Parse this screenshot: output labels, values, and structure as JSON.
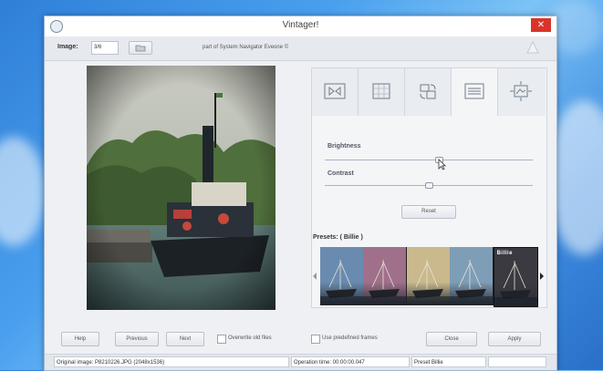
{
  "window": {
    "title": "Vintager!",
    "close_label": "✕"
  },
  "toolbar": {
    "image_label": "Image:",
    "image_value": "3/6",
    "browse_label": "...",
    "credit": "part of System Navigator Eveone ©"
  },
  "panel": {
    "tools": [
      {
        "icon": "frame-icon"
      },
      {
        "icon": "crop-icon"
      },
      {
        "icon": "rotate-icon"
      },
      {
        "icon": "adjust-icon"
      },
      {
        "icon": "resize-icon"
      }
    ],
    "brightness_label": "Brightness",
    "brightness_level": 0.55,
    "contrast_label": "Contrast",
    "contrast_level": 0.5,
    "reset_label": "Reset"
  },
  "presets": {
    "title": "Presets: ( Billie )",
    "items": [
      {
        "name": "preset-1",
        "color": "#6a8bb0"
      },
      {
        "name": "preset-2",
        "color": "#a0708a"
      },
      {
        "name": "preset-3",
        "color": "#c9b98c"
      },
      {
        "name": "preset-4",
        "color": "#7e9db7"
      },
      {
        "name": "Billie",
        "color": "#3b3a40"
      }
    ]
  },
  "actions": {
    "help": "Help",
    "previous": "Previous",
    "next": "Next",
    "overwrite": "Overwrite old files",
    "predefined": "Use predefined frames",
    "close": "Close",
    "apply": "Apply"
  },
  "status": {
    "original": "Original image: P8210226.JPG (2048x1536)",
    "operation": "Operation time: 00:00:00.047",
    "preset": "Preset Billie"
  }
}
